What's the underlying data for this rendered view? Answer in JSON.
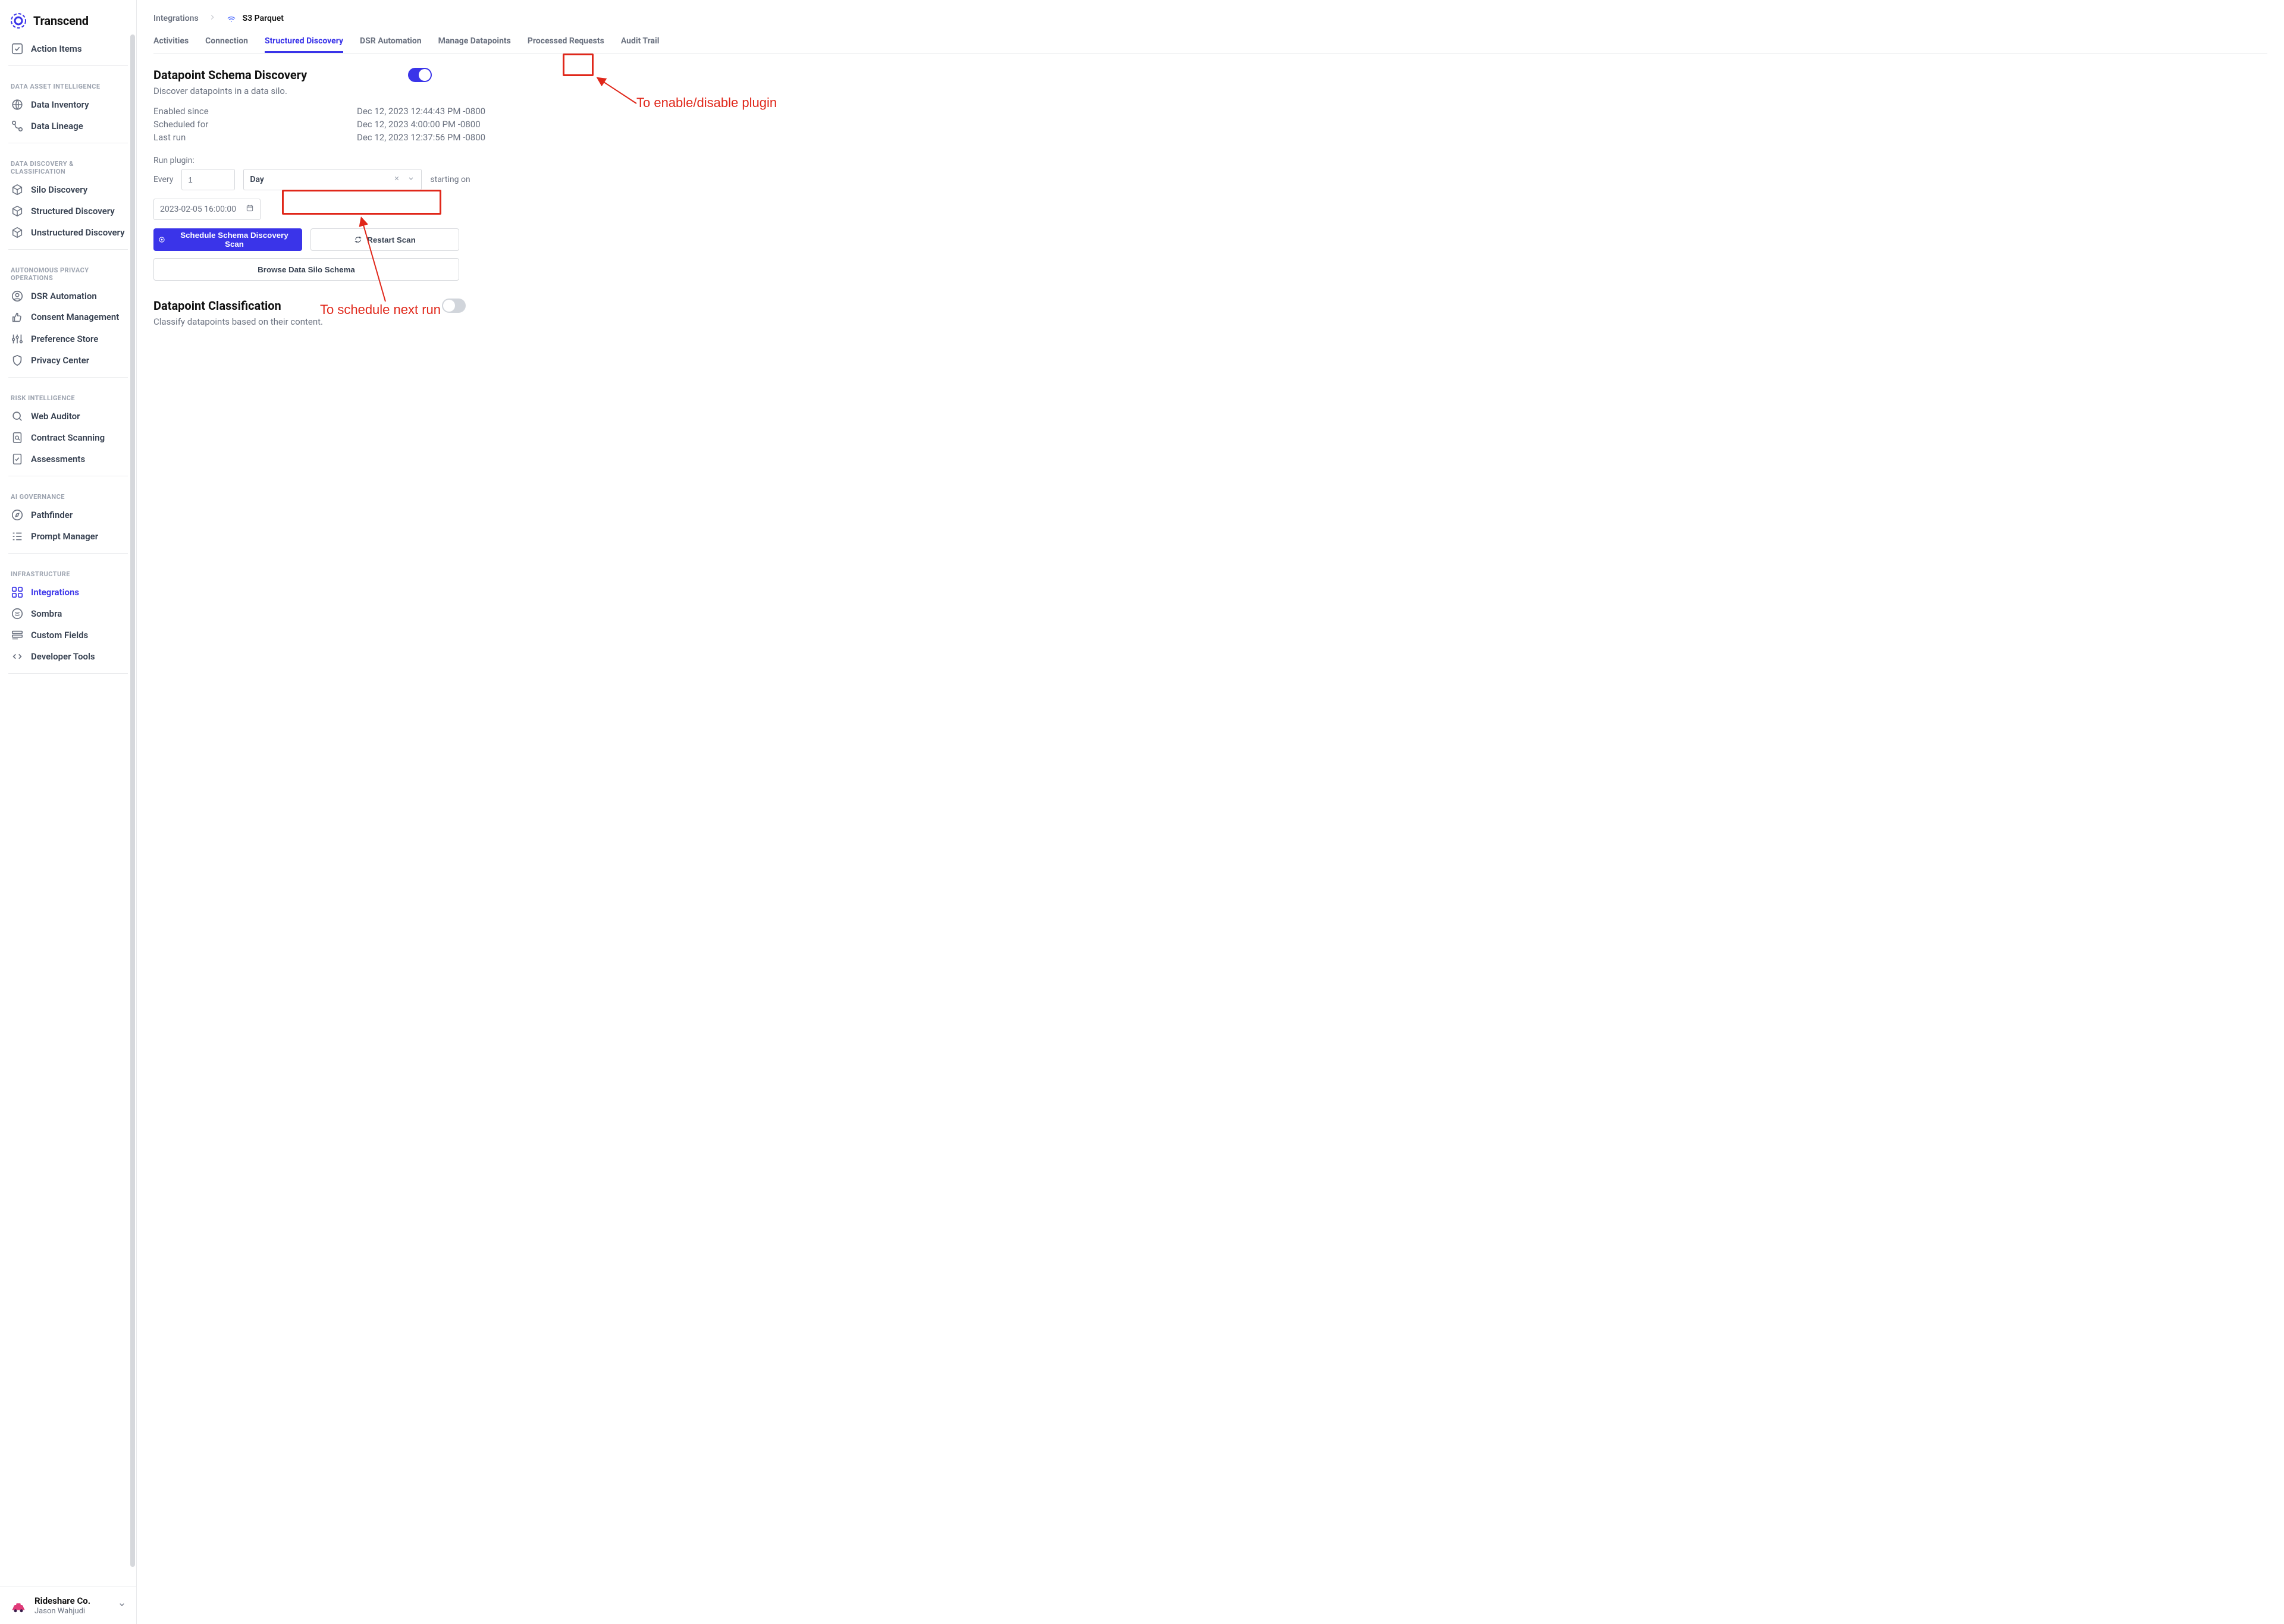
{
  "brand": "Transcend",
  "breadcrumb": {
    "root": "Integrations",
    "current": "S3 Parquet"
  },
  "sidebar": {
    "actionItems": "Action Items",
    "groups": [
      {
        "header": "DATA ASSET INTELLIGENCE",
        "items": [
          {
            "id": "data-inventory",
            "label": "Data Inventory",
            "icon": "globe-icon"
          },
          {
            "id": "data-lineage",
            "label": "Data Lineage",
            "icon": "lineage-icon"
          }
        ]
      },
      {
        "header": "DATA DISCOVERY & CLASSIFICATION",
        "items": [
          {
            "id": "silo-discovery",
            "label": "Silo Discovery",
            "icon": "cube-icon"
          },
          {
            "id": "structured-discovery",
            "label": "Structured Discovery",
            "icon": "cube-icon"
          },
          {
            "id": "unstructured-discovery",
            "label": "Unstructured Discovery",
            "icon": "cube-icon"
          }
        ]
      },
      {
        "header": "AUTONOMOUS PRIVACY OPERATIONS",
        "items": [
          {
            "id": "dsr-automation",
            "label": "DSR Automation",
            "icon": "round-user-icon"
          },
          {
            "id": "consent-management",
            "label": "Consent Management",
            "icon": "thumbs-up-icon",
            "twoLine": true
          },
          {
            "id": "preference-store",
            "label": "Preference Store",
            "icon": "sliders-icon"
          },
          {
            "id": "privacy-center",
            "label": "Privacy Center",
            "icon": "shield-icon"
          }
        ]
      },
      {
        "header": "RISK INTELLIGENCE",
        "items": [
          {
            "id": "web-auditor",
            "label": "Web Auditor",
            "icon": "search-icon"
          },
          {
            "id": "contract-scanning",
            "label": "Contract Scanning",
            "icon": "doc-search-icon"
          },
          {
            "id": "assessments",
            "label": "Assessments",
            "icon": "doc-check-icon"
          }
        ]
      },
      {
        "header": "AI GOVERNANCE",
        "items": [
          {
            "id": "pathfinder",
            "label": "Pathfinder",
            "icon": "compass-icon"
          },
          {
            "id": "prompt-manager",
            "label": "Prompt Manager",
            "icon": "list-icon"
          }
        ]
      },
      {
        "header": "INFRASTRUCTURE",
        "items": [
          {
            "id": "integrations",
            "label": "Integrations",
            "icon": "grid-icon",
            "active": true
          },
          {
            "id": "sombra",
            "label": "Sombra",
            "icon": "sombra-icon"
          },
          {
            "id": "custom-fields",
            "label": "Custom Fields",
            "icon": "fields-icon"
          },
          {
            "id": "developer-tools",
            "label": "Developer Tools",
            "icon": "code-icon"
          }
        ]
      }
    ]
  },
  "org": {
    "name": "Rideshare Co.",
    "user": "Jason Wahjudi"
  },
  "tabs": [
    {
      "id": "activities",
      "label": "Activities"
    },
    {
      "id": "connection",
      "label": "Connection"
    },
    {
      "id": "structured-discovery",
      "label": "Structured Discovery",
      "active": true
    },
    {
      "id": "dsr-automation",
      "label": "DSR Automation"
    },
    {
      "id": "manage-datapoints",
      "label": "Manage Datapoints"
    },
    {
      "id": "processed-requests",
      "label": "Processed Requests"
    },
    {
      "id": "audit-trail",
      "label": "Audit Trail"
    }
  ],
  "schemaDiscovery": {
    "title": "Datapoint Schema Discovery",
    "subtitle": "Discover datapoints in a data silo.",
    "enabled": true,
    "kv": {
      "enabledSinceLabel": "Enabled since",
      "enabledSince": "Dec 12, 2023 12:44:43 PM -0800",
      "scheduledForLabel": "Scheduled for",
      "scheduledFor": "Dec 12, 2023 4:00:00 PM -0800",
      "lastRunLabel": "Last run",
      "lastRun": "Dec 12, 2023 12:37:56 PM -0800"
    },
    "runPluginLabel": "Run plugin:",
    "everyLabel": "Every",
    "intervalValue": "1",
    "unit": "Day",
    "startingLabel": "starting on",
    "startTime": "2023-02-05 16:00:00",
    "scheduleBtn": "Schedule Schema Discovery Scan",
    "restartBtn": "Restart Scan",
    "browseBtn": "Browse Data Silo Schema"
  },
  "classification": {
    "title": "Datapoint Classification",
    "subtitle": "Classify datapoints based on their content.",
    "enabled": false
  },
  "annotations": {
    "toggle": "To enable/disable plugin",
    "schedule": "To schedule next run"
  }
}
